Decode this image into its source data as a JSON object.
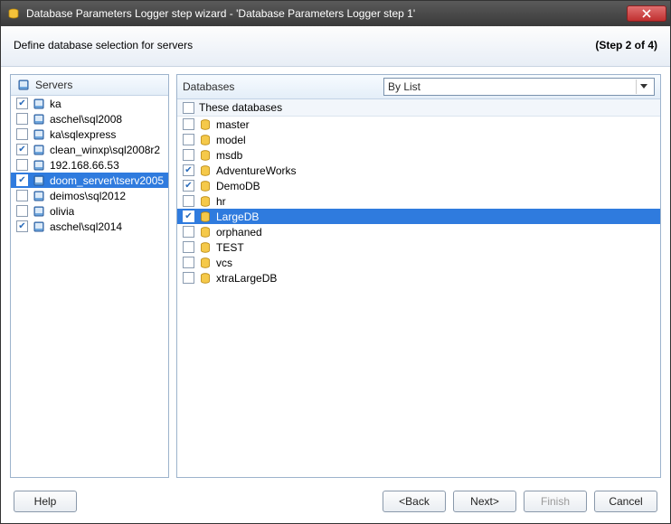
{
  "window": {
    "title": "Database Parameters Logger step wizard - 'Database Parameters Logger step 1'"
  },
  "header": {
    "subtitle": "Define database selection for servers",
    "step": "(Step 2 of 4)"
  },
  "servers": {
    "title": "Servers",
    "items": [
      {
        "label": "ka",
        "checked": true,
        "selected": false
      },
      {
        "label": "aschel\\sql2008",
        "checked": false,
        "selected": false
      },
      {
        "label": "ka\\sqlexpress",
        "checked": false,
        "selected": false
      },
      {
        "label": "clean_winxp\\sql2008r2",
        "checked": true,
        "selected": false
      },
      {
        "label": "192.168.66.53",
        "checked": false,
        "selected": false
      },
      {
        "label": "doom_server\\tserv2005",
        "checked": true,
        "selected": true
      },
      {
        "label": "deimos\\sql2012",
        "checked": false,
        "selected": false
      },
      {
        "label": "olivia",
        "checked": false,
        "selected": false
      },
      {
        "label": "aschel\\sql2014",
        "checked": true,
        "selected": false
      }
    ]
  },
  "databases": {
    "title": "Databases",
    "dropdown_value": "By List",
    "subheader": "These databases",
    "items": [
      {
        "label": "master",
        "checked": false,
        "selected": false
      },
      {
        "label": "model",
        "checked": false,
        "selected": false
      },
      {
        "label": "msdb",
        "checked": false,
        "selected": false
      },
      {
        "label": "AdventureWorks",
        "checked": true,
        "selected": false
      },
      {
        "label": "DemoDB",
        "checked": true,
        "selected": false
      },
      {
        "label": "hr",
        "checked": false,
        "selected": false
      },
      {
        "label": "LargeDB",
        "checked": true,
        "selected": true
      },
      {
        "label": "orphaned",
        "checked": false,
        "selected": false
      },
      {
        "label": "TEST",
        "checked": false,
        "selected": false
      },
      {
        "label": "vcs",
        "checked": false,
        "selected": false
      },
      {
        "label": "xtraLargeDB",
        "checked": false,
        "selected": false
      }
    ]
  },
  "buttons": {
    "help": "Help",
    "back": "<Back",
    "next": "Next>",
    "finish": "Finish",
    "cancel": "Cancel"
  }
}
